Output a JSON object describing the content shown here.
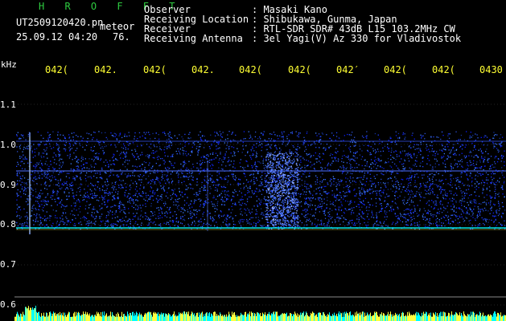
{
  "header": {
    "brand": "H R O F F T",
    "filename": "UT2509120420.pn",
    "meteor_label": "meteor",
    "datetime": "25.09.12 04:20",
    "count": "76."
  },
  "meta": [
    {
      "key": "Observer",
      "value": ": Masaki Kano"
    },
    {
      "key": "Receiving Location",
      "value": ": Shibukawa, Gunma, Japan"
    },
    {
      "key": "Receiver",
      "value": ": RTL-SDR SDR# 43dB L15 103.2MHz CW"
    },
    {
      "key": "Receiving Antenna",
      "value": ": 3el Yagi(V) Az 330 for Vladivostok"
    }
  ],
  "axes": {
    "y_unit": "kHz",
    "x_ticks": [
      "042(",
      "042.",
      "042(",
      "042.",
      "042(",
      "042(",
      "042′",
      "042(",
      "042(",
      "0430"
    ],
    "y_ticks": [
      "1.1",
      "1.0",
      "0.9",
      "0.8",
      "0.7",
      "0.6"
    ]
  },
  "colors": {
    "background": "#000000",
    "noise": "#1e3cff",
    "signal": "#ffff40",
    "baseline": "#00ffff",
    "grid": "#4a4a4a"
  }
}
